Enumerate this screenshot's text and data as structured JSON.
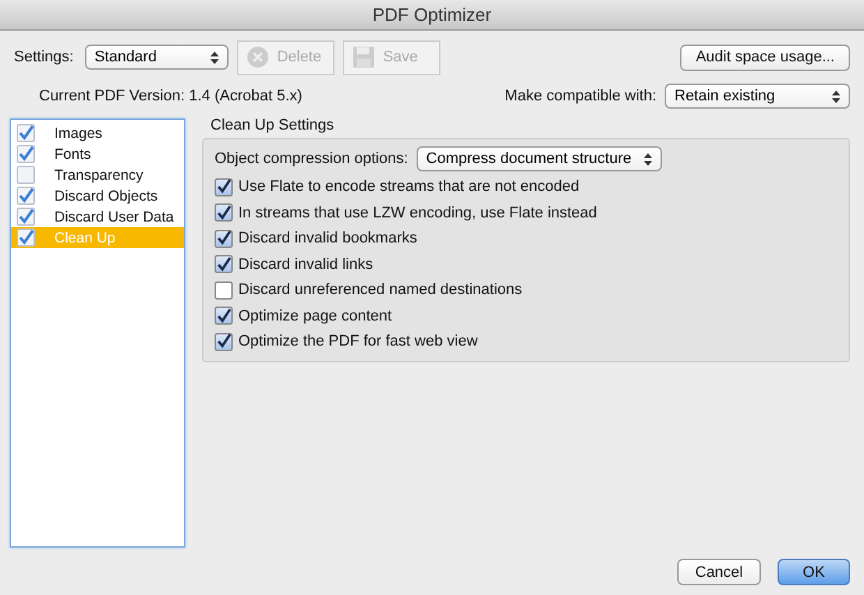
{
  "window": {
    "title": "PDF Optimizer"
  },
  "settings": {
    "label": "Settings:",
    "value": "Standard"
  },
  "toolbar_buttons": [
    {
      "label": "Delete",
      "kind": "delete",
      "disabled": true
    },
    {
      "label": "Save",
      "kind": "save",
      "disabled": true
    }
  ],
  "audit_button": {
    "label": "Audit space usage..."
  },
  "version": {
    "text": "Current PDF Version: 1.4 (Acrobat 5.x)"
  },
  "compatibility": {
    "label": "Make compatible with:",
    "value": "Retain existing"
  },
  "sidebar": {
    "items": [
      {
        "label": "Images",
        "checked": true,
        "selected": false
      },
      {
        "label": "Fonts",
        "checked": true,
        "selected": false
      },
      {
        "label": "Transparency",
        "checked": false,
        "selected": false
      },
      {
        "label": "Discard Objects",
        "checked": true,
        "selected": false
      },
      {
        "label": "Discard User Data",
        "checked": true,
        "selected": false
      },
      {
        "label": "Clean Up",
        "checked": true,
        "selected": true
      }
    ]
  },
  "panel": {
    "title": "Clean Up Settings",
    "compression": {
      "label": "Object compression options:",
      "value": "Compress document structure"
    },
    "options": [
      {
        "label": "Use Flate to encode streams that are not encoded",
        "checked": true
      },
      {
        "label": "In streams that use LZW encoding, use Flate instead",
        "checked": true
      },
      {
        "label": "Discard invalid bookmarks",
        "checked": true
      },
      {
        "label": "Discard invalid links",
        "checked": true
      },
      {
        "label": "Discard unreferenced named destinations",
        "checked": false
      },
      {
        "label": "Optimize page content",
        "checked": true
      },
      {
        "label": "Optimize the PDF for fast web view",
        "checked": true
      }
    ]
  },
  "buttons": [
    {
      "label": "Cancel",
      "default": false
    },
    {
      "label": "OK",
      "default": true
    }
  ]
}
